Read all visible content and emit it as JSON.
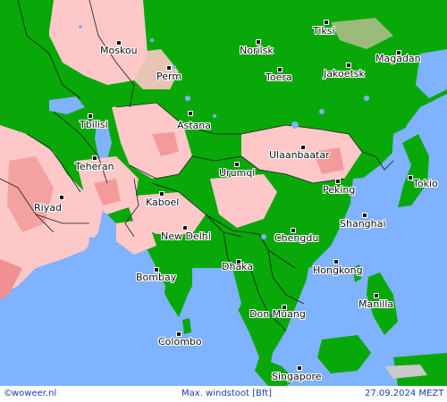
{
  "cities": [
    {
      "name": "Moskou"
    },
    {
      "name": "Norilsk"
    },
    {
      "name": "Tiksi"
    },
    {
      "name": "Magadan"
    },
    {
      "name": "Perm"
    },
    {
      "name": "Toera"
    },
    {
      "name": "Jakoetsk"
    },
    {
      "name": "Tbilisi"
    },
    {
      "name": "Astana"
    },
    {
      "name": "Ulaanbaatar"
    },
    {
      "name": "Teheran"
    },
    {
      "name": "Urumqi"
    },
    {
      "name": "Peking"
    },
    {
      "name": "Tokio"
    },
    {
      "name": "Riyad"
    },
    {
      "name": "Kaboel"
    },
    {
      "name": "Shanghai"
    },
    {
      "name": "New Delhi"
    },
    {
      "name": "Chengdu"
    },
    {
      "name": "Dhaka"
    },
    {
      "name": "Bombay"
    },
    {
      "name": "Hongkong"
    },
    {
      "name": "Manilla"
    },
    {
      "name": "Don Muang"
    },
    {
      "name": "Colombo"
    },
    {
      "name": "Singapore"
    }
  ],
  "footer": {
    "brand_icon": "copyright-icon",
    "brand": "woweer.nl",
    "title": "Max. windstoot [Bft]",
    "date": "27.09.2024 MEZT"
  },
  "colors": {
    "sea": "#7fb2ff",
    "land_low_wind": "#08a808",
    "land_moderate_wind": "#ffc8c8",
    "land_stronger_wind": "#f09090",
    "borders": "#1a1a1a",
    "footer_text": "#1a3cb0"
  }
}
